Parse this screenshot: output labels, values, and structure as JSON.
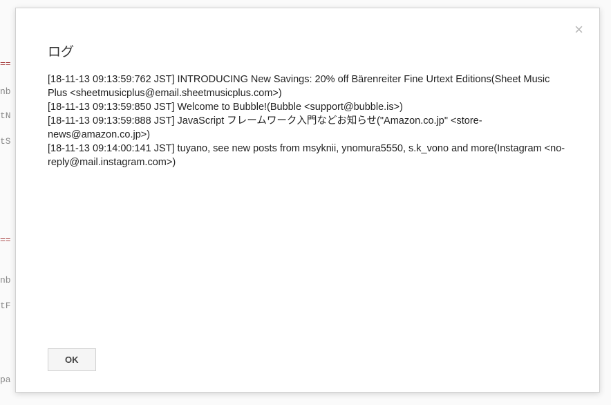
{
  "background": {
    "line1": "==",
    "line2": "nb",
    "line3": "tN",
    "line4": "tS",
    "line5": "==",
    "line6": "nb",
    "line7": "tF",
    "line8": "pa"
  },
  "dialog": {
    "title": "ログ",
    "log_entries": [
      "[18-11-13 09:13:59:762 JST] INTRODUCING New Savings: 20% off Bärenreiter Fine Urtext Editions(Sheet Music Plus <sheetmusicplus@email.sheetmusicplus.com>)",
      "[18-11-13 09:13:59:850 JST] Welcome to Bubble!(Bubble <support@bubble.is>)",
      "[18-11-13 09:13:59:888 JST] JavaScript フレームワーク入門などお知らせ(\"Amazon.co.jp\" <store-news@amazon.co.jp>)",
      "[18-11-13 09:14:00:141 JST] tuyano, see new posts from msyknii, ynomura5550, s.k_vono and more(Instagram <no-reply@mail.instagram.com>)"
    ],
    "ok_label": "OK",
    "close_label": "×"
  }
}
